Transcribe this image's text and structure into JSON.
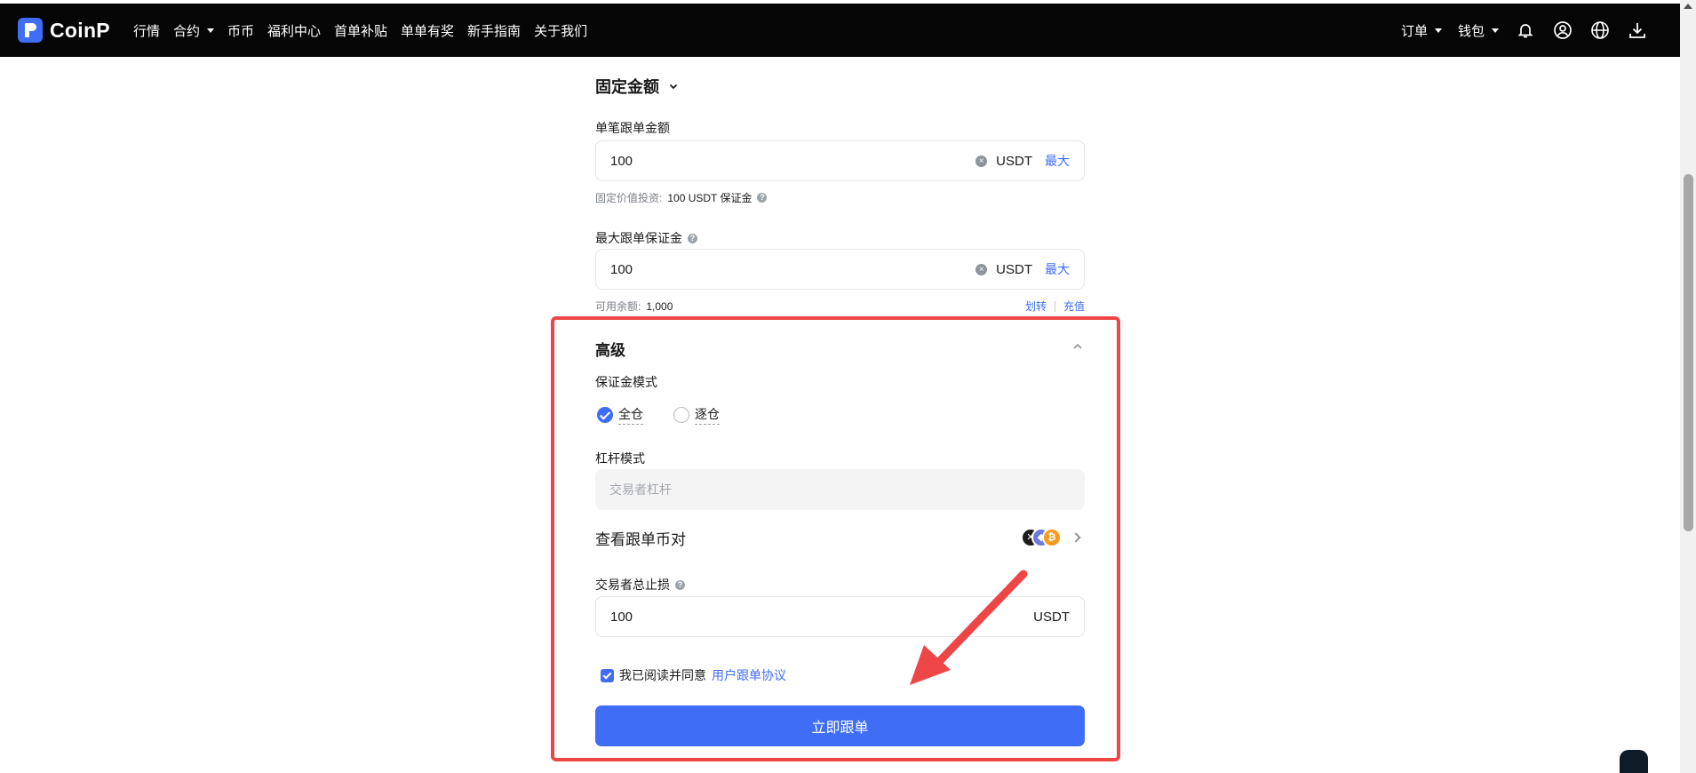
{
  "nav": {
    "brand": "CoinP",
    "items": [
      {
        "label": "行情",
        "dropdown": false
      },
      {
        "label": "合约",
        "dropdown": true
      },
      {
        "label": "币币",
        "dropdown": false
      },
      {
        "label": "福利中心",
        "dropdown": false
      },
      {
        "label": "首单补贴",
        "dropdown": false
      },
      {
        "label": "单单有奖",
        "dropdown": false
      },
      {
        "label": "新手指南",
        "dropdown": false
      },
      {
        "label": "关于我们",
        "dropdown": false
      }
    ],
    "orders_label": "订单",
    "wallet_label": "钱包",
    "icons": [
      "bell-icon",
      "user-icon",
      "globe-icon",
      "download-icon"
    ]
  },
  "form": {
    "mode_selector": "固定金额",
    "single_amount": {
      "label": "单笔跟单金额",
      "value": "100",
      "unit": "USDT",
      "max_label": "最大",
      "hint_prefix": "固定价值投资:",
      "hint_value": "100 USDT 保证金"
    },
    "max_margin": {
      "label": "最大跟单保证金",
      "value": "100",
      "unit": "USDT",
      "max_label": "最大",
      "balance_label": "可用余额:",
      "balance_value": "1,000",
      "transfer_label": "划转",
      "deposit_label": "充值"
    },
    "advanced": {
      "title": "高级",
      "margin_mode_label": "保证金模式",
      "margin_options": [
        {
          "label": "全仓",
          "checked": true
        },
        {
          "label": "逐仓",
          "checked": false
        }
      ],
      "leverage_label": "杠杆模式",
      "leverage_placeholder": "交易者杠杆",
      "pairs_label": "查看跟单币对",
      "pair_coins": [
        "XRP",
        "ETH",
        "BTC"
      ],
      "stop_loss_label": "交易者总止损",
      "stop_loss_value": "100",
      "stop_loss_unit": "USDT"
    },
    "agreement": {
      "text": "我已阅读并同意",
      "link": "用户跟单协议",
      "checked": true
    },
    "submit_label": "立即跟单"
  },
  "colors": {
    "accent": "#3f6df6",
    "highlight": "#ee4646",
    "navbar": "#050505"
  }
}
